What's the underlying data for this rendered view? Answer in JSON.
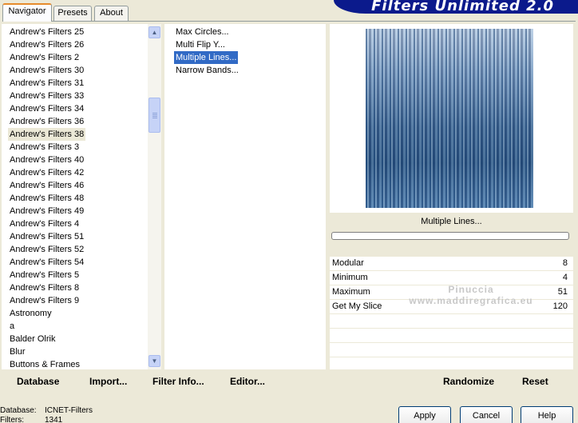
{
  "app": {
    "banner_title": "Filters Unlimited 2.0"
  },
  "tabs": [
    {
      "label": "Navigator",
      "active": true
    },
    {
      "label": "Presets",
      "active": false
    },
    {
      "label": "About",
      "active": false
    }
  ],
  "categories": [
    "Andrew's Filters 25",
    "Andrew's Filters 26",
    "Andrew's Filters 2",
    "Andrew's Filters 30",
    "Andrew's Filters 31",
    "Andrew's Filters 33",
    "Andrew's Filters 34",
    "Andrew's Filters 36",
    "Andrew's Filters 38",
    "Andrew's Filters 3",
    "Andrew's Filters 40",
    "Andrew's Filters 42",
    "Andrew's Filters 46",
    "Andrew's Filters 48",
    "Andrew's Filters 49",
    "Andrew's Filters 4",
    "Andrew's Filters 51",
    "Andrew's Filters 52",
    "Andrew's Filters 54",
    "Andrew's Filters 5",
    "Andrew's Filters 8",
    "Andrew's Filters 9",
    "Astronomy",
    "a",
    "Balder Olrik",
    "Blur",
    "Buttons & Frames"
  ],
  "selected_category": "Andrew's Filters 38",
  "filters": [
    "Max Circles...",
    "Multi Flip Y...",
    "Multiple Lines...",
    "Narrow Bands..."
  ],
  "selected_filter": "Multiple Lines...",
  "preview": {
    "filter_name": "Multiple Lines..."
  },
  "params": [
    {
      "label": "Modular",
      "value": "8"
    },
    {
      "label": "Minimum",
      "value": "4"
    },
    {
      "label": "Maximum",
      "value": "51"
    },
    {
      "label": "Get My Slice",
      "value": "120"
    }
  ],
  "watermark": {
    "line1": "Pinuccia",
    "line2": "www.maddiregrafica.eu"
  },
  "left_buttons": {
    "database": "Database",
    "import": "Import...",
    "filter_info": "Filter Info...",
    "editor": "Editor..."
  },
  "right_buttons": {
    "randomize": "Randomize",
    "reset": "Reset"
  },
  "status": {
    "database_label": "Database:",
    "database_value": "ICNET-Filters",
    "filters_label": "Filters:",
    "filters_value": "1341"
  },
  "dialog_buttons": {
    "apply": "Apply",
    "cancel": "Cancel",
    "help": "Help"
  }
}
